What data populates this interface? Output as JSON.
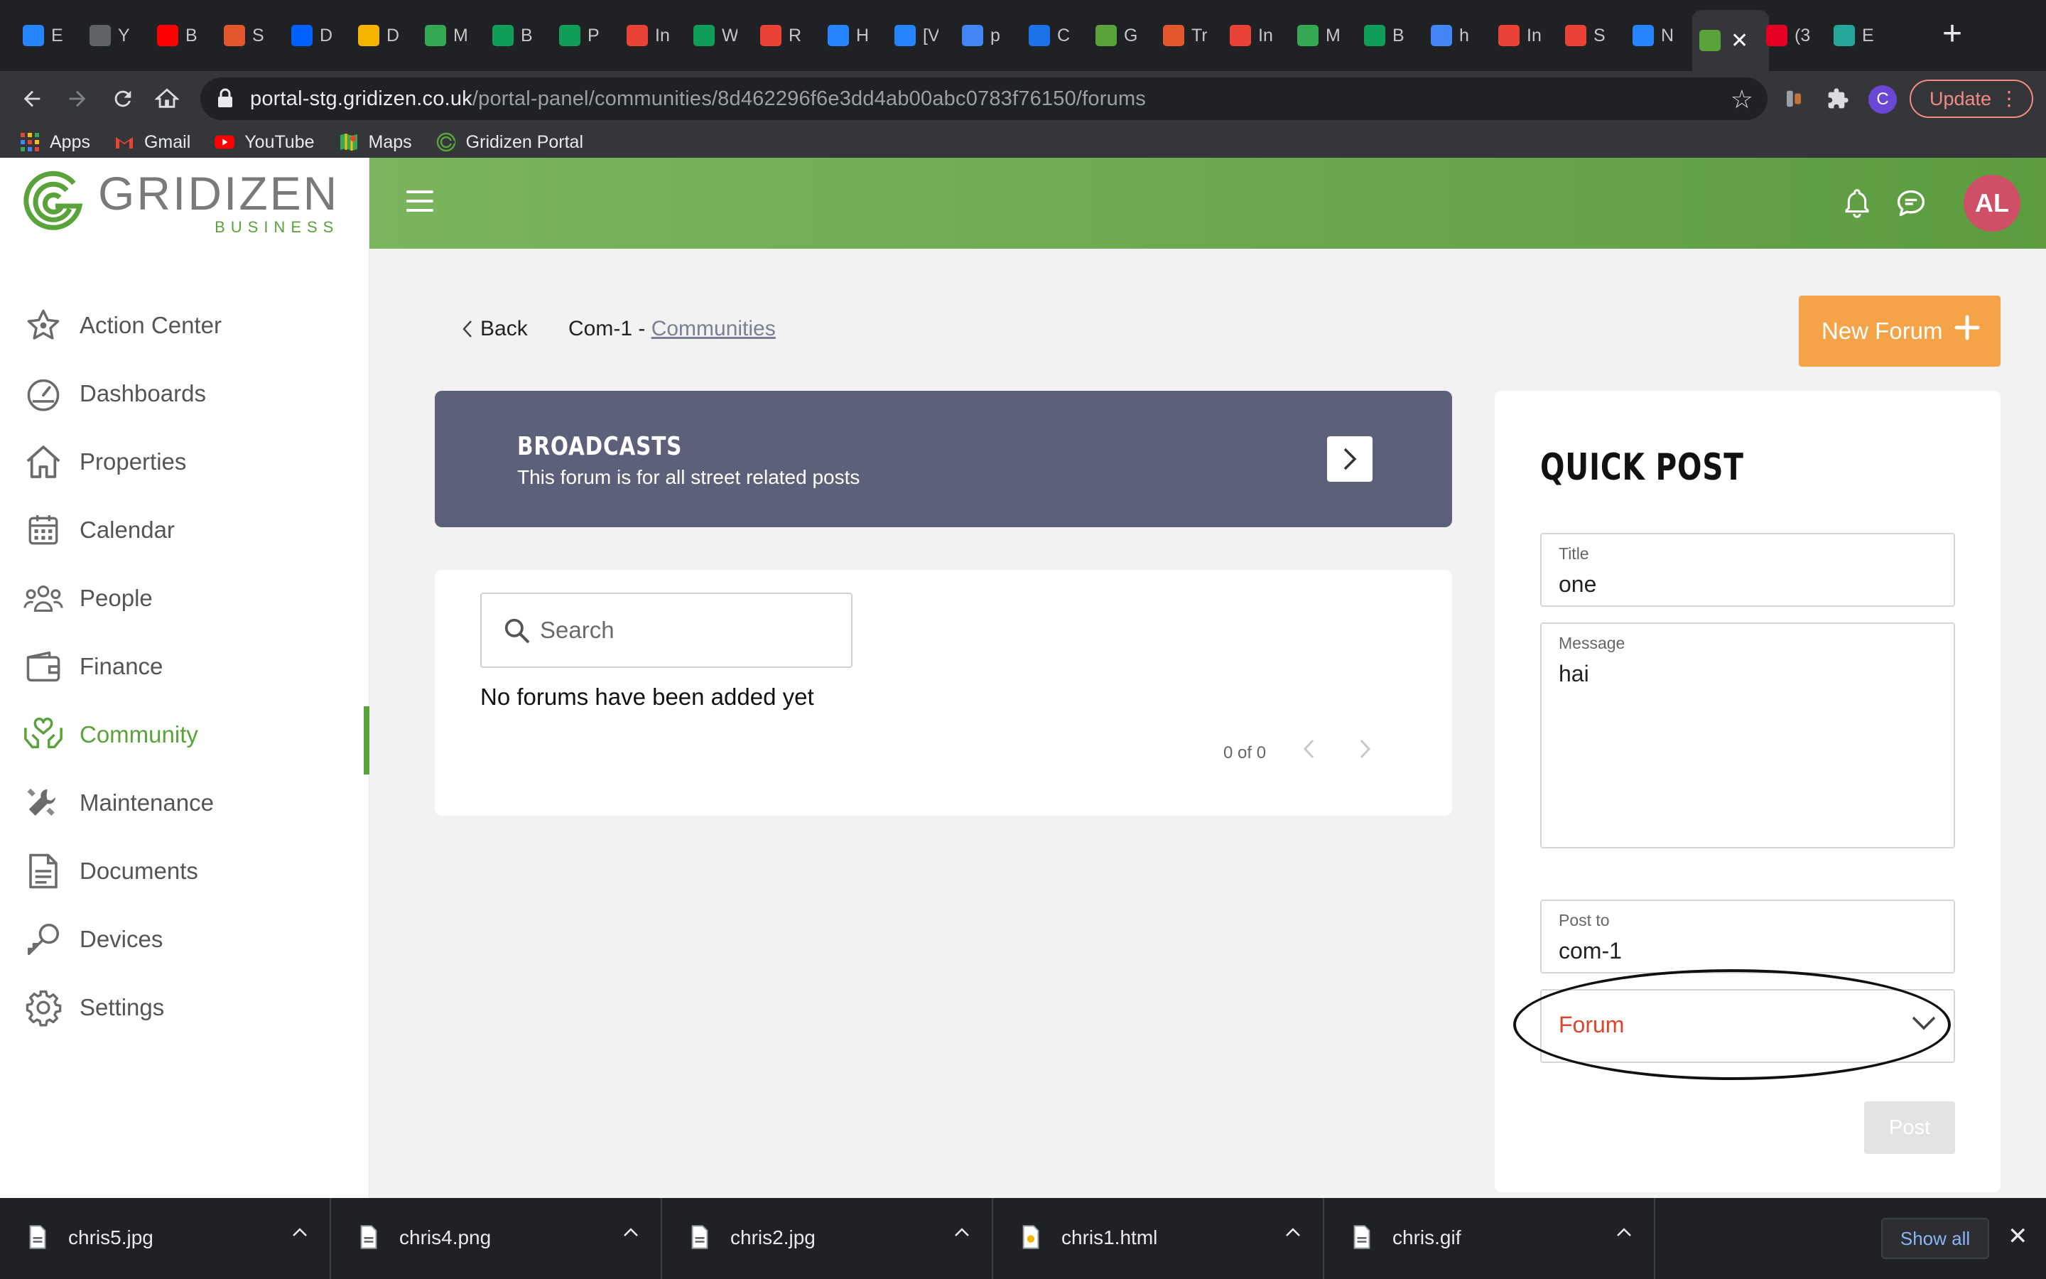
{
  "browser": {
    "tabs": [
      {
        "icon": "jira-icon",
        "label": "E",
        "color": "#2684ff"
      },
      {
        "icon": "y-icon",
        "label": "Y",
        "color": "#5f6368"
      },
      {
        "icon": "youtube-icon",
        "label": "B",
        "color": "#ff0000"
      },
      {
        "icon": "gridizen-dev-icon",
        "label": "S",
        "color": "#e4572e"
      },
      {
        "icon": "dropbox-icon",
        "label": "D",
        "color": "#0061ff"
      },
      {
        "icon": "doc-icon",
        "label": "D",
        "color": "#f4b400"
      },
      {
        "icon": "drive-icon",
        "label": "M",
        "color": "#34a853"
      },
      {
        "icon": "sheets-icon",
        "label": "B",
        "color": "#0f9d58"
      },
      {
        "icon": "sheets-icon",
        "label": "P",
        "color": "#0f9d58"
      },
      {
        "icon": "gmail-icon",
        "label": "In",
        "color": "#ea4335"
      },
      {
        "icon": "sheets-icon",
        "label": "W",
        "color": "#0f9d58"
      },
      {
        "icon": "gmail-icon",
        "label": "R",
        "color": "#ea4335"
      },
      {
        "icon": "confluence-icon",
        "label": "H",
        "color": "#2684ff"
      },
      {
        "icon": "jira-icon",
        "label": "[V",
        "color": "#2684ff"
      },
      {
        "icon": "google-icon",
        "label": "p",
        "color": "#4285f4"
      },
      {
        "icon": "calendar-icon",
        "label": "C",
        "color": "#1a73e8"
      },
      {
        "icon": "gridizen-icon",
        "label": "G",
        "color": "#5aa23a"
      },
      {
        "icon": "gridizen-dev-icon",
        "label": "Tr",
        "color": "#e4572e"
      },
      {
        "icon": "gmail-icon",
        "label": "In",
        "color": "#ea4335"
      },
      {
        "icon": "drive-icon",
        "label": "M",
        "color": "#34a853"
      },
      {
        "icon": "sheets-icon",
        "label": "B",
        "color": "#0f9d58"
      },
      {
        "icon": "google-icon",
        "label": "h",
        "color": "#4285f4"
      },
      {
        "icon": "gmail-icon",
        "label": "In",
        "color": "#ea4335"
      },
      {
        "icon": "gmail-icon",
        "label": "S",
        "color": "#ea4335"
      },
      {
        "icon": "confluence-icon",
        "label": "N",
        "color": "#2684ff"
      },
      {
        "icon": "gridizen-icon",
        "label": "",
        "color": "#5aa23a",
        "active": true
      },
      {
        "icon": "pinterest-icon",
        "label": "(3",
        "color": "#e60023"
      },
      {
        "icon": "feather-icon",
        "label": "E",
        "color": "#26a69a"
      }
    ],
    "url_host": "portal-stg.gridizen.co.uk",
    "url_path": "/portal-panel/communities/8d462296f6e3dd4ab00abc0783f76150/forums",
    "profile_initial": "C",
    "update_label": "Update",
    "bookmarks": [
      {
        "label": "Apps",
        "icon": "apps-grid-icon"
      },
      {
        "label": "Gmail",
        "icon": "gmail-icon"
      },
      {
        "label": "YouTube",
        "icon": "youtube-icon"
      },
      {
        "label": "Maps",
        "icon": "maps-icon"
      },
      {
        "label": "Gridizen Portal",
        "icon": "gridizen-icon"
      }
    ]
  },
  "logo": {
    "main": "GRIDIZEN",
    "sub": "BUSINESS"
  },
  "sidebar": {
    "items": [
      {
        "label": "Action Center",
        "icon": "star-icon"
      },
      {
        "label": "Dashboards",
        "icon": "gauge-icon"
      },
      {
        "label": "Properties",
        "icon": "house-icon"
      },
      {
        "label": "Calendar",
        "icon": "calendar-icon"
      },
      {
        "label": "People",
        "icon": "people-icon"
      },
      {
        "label": "Finance",
        "icon": "wallet-icon"
      },
      {
        "label": "Community",
        "icon": "community-hands-icon",
        "active": true
      },
      {
        "label": "Maintenance",
        "icon": "tools-icon"
      },
      {
        "label": "Documents",
        "icon": "document-icon"
      },
      {
        "label": "Devices",
        "icon": "key-icon"
      },
      {
        "label": "Settings",
        "icon": "gear-icon"
      }
    ]
  },
  "header": {
    "avatar_initials": "AL"
  },
  "page": {
    "back_label": "Back",
    "crumb_current": "Com-1 - ",
    "crumb_link": "Communities",
    "new_forum_label": "New Forum"
  },
  "broadcast": {
    "title": "BROADCASTS",
    "description": "This forum is for all street related posts"
  },
  "forums": {
    "search_placeholder": "Search",
    "empty_message": "No forums have been added yet",
    "pager": "0 of 0"
  },
  "quick_post": {
    "title": "QUICK POST",
    "title_label": "Title",
    "title_value": "one",
    "message_label": "Message",
    "message_value": "hai",
    "post_to_label": "Post to",
    "post_to_value": "com-1",
    "type_value": "Forum",
    "post_label": "Post"
  },
  "downloads": {
    "files": [
      "chris5.jpg",
      "chris4.png",
      "chris2.jpg",
      "chris1.html",
      "chris.gif"
    ],
    "show_all_label": "Show all"
  },
  "colors": {
    "brand_green": "#5aa23a",
    "header_green": "#6aa84f",
    "accent_orange": "#f4a446",
    "broadcast_bg": "#5c6078",
    "avatar": "#cf4f67",
    "select_text": "#e0452b"
  }
}
